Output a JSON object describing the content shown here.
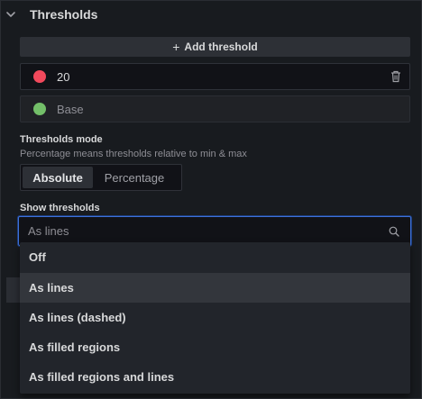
{
  "section": {
    "title": "Thresholds"
  },
  "add_threshold": {
    "label": "Add threshold"
  },
  "thresholds": [
    {
      "value": "20",
      "color": "#f2495c"
    },
    {
      "value": "Base",
      "color": "#73bf69"
    }
  ],
  "thresholds_mode": {
    "label": "Thresholds mode",
    "description": "Percentage means thresholds relative to min & max",
    "options": [
      "Absolute",
      "Percentage"
    ],
    "selected": "Absolute"
  },
  "show_thresholds": {
    "label": "Show thresholds",
    "placeholder": "As lines",
    "options": [
      "Off",
      "As lines",
      "As lines (dashed)",
      "As filled regions",
      "As filled regions and lines"
    ],
    "highlighted": "As lines"
  },
  "colors": {
    "accent_blue": "#3d71d9",
    "panel_bg": "#181b1f",
    "input_bg": "#111217"
  }
}
